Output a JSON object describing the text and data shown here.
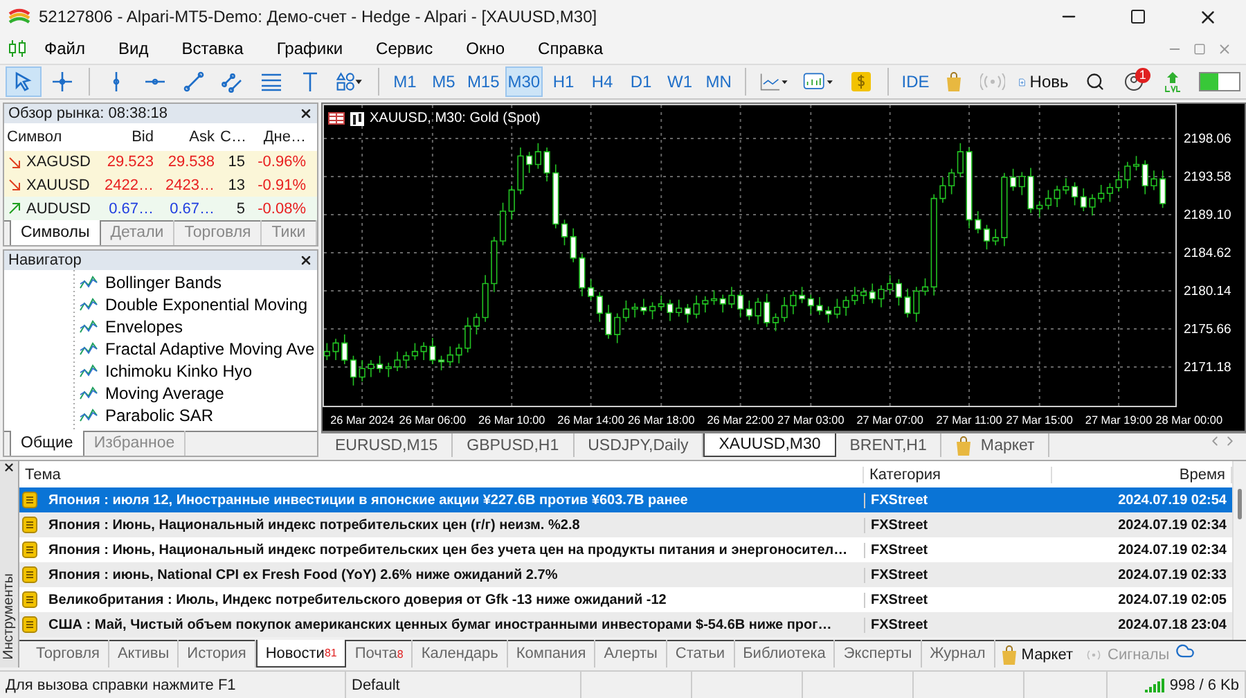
{
  "window": {
    "title": "52127806 - Alpari-MT5-Demo: Демо-счет - Hedge - Alpari - [XAUUSD,M30]"
  },
  "menu": [
    "Файл",
    "Вид",
    "Вставка",
    "Графики",
    "Сервис",
    "Окно",
    "Справка"
  ],
  "toolbar": {
    "tools": [
      {
        "kind": "cursor",
        "selected": true
      },
      {
        "kind": "crosshair",
        "selected": false
      },
      {
        "kind": "vline",
        "selected": false
      },
      {
        "kind": "hline",
        "selected": false
      },
      {
        "kind": "trendline",
        "selected": false
      },
      {
        "kind": "channel",
        "selected": false
      },
      {
        "kind": "fibo",
        "selected": false
      },
      {
        "kind": "text",
        "selected": false
      },
      {
        "kind": "shapes",
        "selected": false
      }
    ],
    "timeframes": [
      {
        "label": "M1",
        "selected": false
      },
      {
        "label": "M5",
        "selected": false
      },
      {
        "label": "M15",
        "selected": false
      },
      {
        "label": "M30",
        "selected": true
      },
      {
        "label": "H1",
        "selected": false
      },
      {
        "label": "H4",
        "selected": false
      },
      {
        "label": "D1",
        "selected": false
      },
      {
        "label": "W1",
        "selected": false
      },
      {
        "label": "MN",
        "selected": false
      }
    ],
    "ide": "IDE",
    "new_order": "Новь",
    "notification_count": "1",
    "level": 0.45
  },
  "market_watch": {
    "title": "Обзор рынка: 08:38:18",
    "columns": [
      "Символ",
      "Bid",
      "Ask",
      "С…",
      "Дне…"
    ],
    "rows": [
      {
        "symbol": "XAGUSD",
        "bid": "29.523",
        "ask": "29.538",
        "spread": "15",
        "change": "-0.96%",
        "kind": "down"
      },
      {
        "symbol": "XAUUSD",
        "bid": "2422…",
        "ask": "2423…",
        "spread": "13",
        "change": "-0.91%",
        "kind": "down"
      },
      {
        "symbol": "AUDUSD",
        "bid": "0.67…",
        "ask": "0.67…",
        "spread": "5",
        "change": "-0.08%",
        "kind": "up"
      }
    ],
    "tabs": [
      {
        "label": "Символы",
        "selected": true
      },
      {
        "label": "Детали",
        "selected": false
      },
      {
        "label": "Торговля",
        "selected": false
      },
      {
        "label": "Тики",
        "selected": false
      }
    ]
  },
  "navigator": {
    "title": "Навигатор",
    "items": [
      "Bollinger Bands",
      "Double Exponential Moving",
      "Envelopes",
      "Fractal Adaptive Moving Ave",
      "Ichimoku Kinko Hyo",
      "Moving Average",
      "Parabolic SAR"
    ],
    "tabs": [
      {
        "label": "Общие",
        "selected": true
      },
      {
        "label": "Избранное",
        "selected": false
      }
    ]
  },
  "chart": {
    "chart_data": {
      "type": "candlestick",
      "title": "XAUUSD, M30:  Gold (Spot)",
      "grid": true,
      "categories": [
        null,
        null,
        null,
        null,
        "26 Mar 2024",
        null,
        null,
        null,
        null,
        null,
        null,
        null,
        "26 Mar 06:00",
        null,
        null,
        null,
        null,
        null,
        null,
        null,
        null,
        "26 Mar 10:00",
        null,
        null,
        null,
        null,
        null,
        null,
        null,
        null,
        "26 Mar 14:00",
        null,
        null,
        null,
        null,
        null,
        null,
        null,
        "26 Mar 18:00",
        null,
        null,
        null,
        null,
        null,
        null,
        null,
        null,
        "26 Mar 22:00",
        null,
        null,
        null,
        null,
        null,
        null,
        null,
        "27 Mar 03:00",
        null,
        null,
        null,
        null,
        null,
        null,
        null,
        null,
        "27 Mar 07:00",
        null,
        null,
        null,
        null,
        null,
        null,
        null,
        null,
        "27 Mar 11:00",
        null,
        null,
        null,
        null,
        null,
        null,
        null,
        "27 Mar 15:00",
        null,
        null,
        null,
        null,
        null,
        null,
        null,
        null,
        "27 Mar 19:00",
        null,
        null,
        null,
        null,
        null,
        null,
        null,
        "28 Mar 00:00"
      ],
      "ohlc": [
        [
          2172.5,
          2174,
          2172,
          2173
        ],
        [
          2173,
          2174.5,
          2172,
          2174
        ],
        [
          2174,
          2175,
          2171.5,
          2172
        ],
        [
          2172,
          2172.5,
          2169,
          2170
        ],
        [
          2170,
          2172,
          2169.5,
          2171
        ],
        [
          2171,
          2172,
          2170,
          2171.5
        ],
        [
          2171.5,
          2172.5,
          2170.5,
          2171
        ],
        [
          2171,
          2171.7,
          2170,
          2171.2
        ],
        [
          2171.2,
          2173,
          2170.7,
          2172
        ],
        [
          2172,
          2173,
          2171,
          2172.5
        ],
        [
          2172.5,
          2174,
          2172,
          2173
        ],
        [
          2173,
          2174.1,
          2172,
          2173.6
        ],
        [
          2173.6,
          2174.6,
          2171.5,
          2172
        ],
        [
          2172,
          2172.5,
          2170.8,
          2171.8
        ],
        [
          2171.8,
          2173.6,
          2171.3,
          2172.6
        ],
        [
          2172.6,
          2173.9,
          2171.6,
          2173.4
        ],
        [
          2173.4,
          2177,
          2172.9,
          2176
        ],
        [
          2176,
          2177.5,
          2175,
          2177
        ],
        [
          2177,
          2182,
          2176.5,
          2181
        ],
        [
          2181,
          2186.5,
          2180,
          2186
        ],
        [
          2186,
          2190.5,
          2185.5,
          2189.5
        ],
        [
          2189.5,
          2192.5,
          2188.5,
          2192
        ],
        [
          2192,
          2197,
          2191.5,
          2196
        ],
        [
          2196,
          2196.5,
          2194,
          2195
        ],
        [
          2195,
          2197.5,
          2194.5,
          2196.5
        ],
        [
          2196.5,
          2197,
          2193,
          2194
        ],
        [
          2194,
          2195,
          2187.5,
          2188
        ],
        [
          2188,
          2188.5,
          2185.5,
          2186.5
        ],
        [
          2186.5,
          2187.5,
          2183.5,
          2184
        ],
        [
          2184,
          2184.5,
          2179.5,
          2180.5
        ],
        [
          2180.5,
          2181.5,
          2179,
          2179.5
        ],
        [
          2179.5,
          2180,
          2176.5,
          2177.5
        ],
        [
          2177.5,
          2178.5,
          2174.5,
          2175
        ],
        [
          2175,
          2177.5,
          2174,
          2177
        ],
        [
          2177,
          2179,
          2176.5,
          2178
        ],
        [
          2178,
          2178.7,
          2177,
          2178.2
        ],
        [
          2178.2,
          2179.2,
          2177.3,
          2177.8
        ],
        [
          2177.8,
          2178.8,
          2176.8,
          2178.3
        ],
        [
          2178.3,
          2179.6,
          2177.8,
          2178.6
        ],
        [
          2178.6,
          2179.1,
          2176.6,
          2177.6
        ],
        [
          2177.6,
          2179.1,
          2177.1,
          2178.1
        ],
        [
          2178.1,
          2178.6,
          2176.4,
          2177.4
        ],
        [
          2177.4,
          2179.6,
          2176.9,
          2178.6
        ],
        [
          2178.6,
          2179.5,
          2177.6,
          2179
        ],
        [
          2179,
          2180.2,
          2178.5,
          2179.2
        ],
        [
          2179.2,
          2179.7,
          2177.6,
          2178.6
        ],
        [
          2178.6,
          2180.6,
          2178.1,
          2179.6
        ],
        [
          2179.6,
          2180.1,
          2177,
          2178
        ],
        [
          2178,
          2179,
          2176.7,
          2177.2
        ],
        [
          2177.2,
          2179.3,
          2176.2,
          2178.8
        ],
        [
          2178.8,
          2179.8,
          2175.9,
          2176.4
        ],
        [
          2176.4,
          2177.5,
          2175.4,
          2177
        ],
        [
          2177,
          2179.4,
          2176.5,
          2178.4
        ],
        [
          2178.4,
          2180.1,
          2177.4,
          2179.6
        ],
        [
          2179.6,
          2180.6,
          2178.7,
          2179.2
        ],
        [
          2179.2,
          2179.7,
          2177.4,
          2178.4
        ],
        [
          2178.4,
          2179.4,
          2177.3,
          2177.8
        ],
        [
          2177.8,
          2178.3,
          2176.4,
          2177.4
        ],
        [
          2177.4,
          2179.2,
          2176.9,
          2178.2
        ],
        [
          2178.2,
          2179.5,
          2177.2,
          2179
        ],
        [
          2179,
          2180.6,
          2178.5,
          2179.6
        ],
        [
          2179.6,
          2180.5,
          2178.6,
          2180
        ],
        [
          2180,
          2181,
          2178.7,
          2179.2
        ],
        [
          2179.2,
          2180.8,
          2178.2,
          2180.3
        ],
        [
          2180.3,
          2182,
          2179.8,
          2181
        ],
        [
          2181,
          2181.5,
          2178.4,
          2179.4
        ],
        [
          2179.4,
          2180.4,
          2177,
          2177.5
        ],
        [
          2177.5,
          2180.6,
          2176.5,
          2180.1
        ],
        [
          2180.1,
          2181.6,
          2179.6,
          2180.6
        ],
        [
          2180.6,
          2191.5,
          2179.6,
          2191
        ],
        [
          2191,
          2193.5,
          2190.5,
          2192.5
        ],
        [
          2192.5,
          2194.5,
          2191.5,
          2194
        ],
        [
          2194,
          2197.5,
          2193.5,
          2196.5
        ],
        [
          2196.5,
          2197,
          2187.5,
          2188.5
        ],
        [
          2188.5,
          2189.5,
          2186.9,
          2187.4
        ],
        [
          2187.4,
          2187.9,
          2185,
          2186
        ],
        [
          2186,
          2187.4,
          2185.5,
          2186.4
        ],
        [
          2186.4,
          2194,
          2185.4,
          2193.5
        ],
        [
          2193.5,
          2194.5,
          2191.9,
          2192.4
        ],
        [
          2192.4,
          2194.1,
          2191.4,
          2193.6
        ],
        [
          2193.6,
          2194.6,
          2189.3,
          2189.8
        ],
        [
          2189.8,
          2190.7,
          2188.8,
          2190.2
        ],
        [
          2190.2,
          2192,
          2189.7,
          2191
        ],
        [
          2191,
          2192.5,
          2190,
          2192
        ],
        [
          2192,
          2193.4,
          2191.5,
          2192.4
        ],
        [
          2192.4,
          2192.9,
          2190.2,
          2191.2
        ],
        [
          2191.2,
          2192.2,
          2189.5,
          2190
        ],
        [
          2190,
          2191.5,
          2189,
          2191
        ],
        [
          2191,
          2192.6,
          2190.5,
          2191.6
        ],
        [
          2191.6,
          2192.8,
          2190.6,
          2192.3
        ],
        [
          2192.3,
          2194.2,
          2191.8,
          2193.2
        ],
        [
          2193.2,
          2195.3,
          2192.2,
          2194.8
        ],
        [
          2194.8,
          2196,
          2194.3,
          2195
        ],
        [
          2195,
          2195.5,
          2191.5,
          2192.5
        ],
        [
          2192.5,
          2194.3,
          2192,
          2193.3
        ],
        [
          2193.3,
          2194.3,
          2189.9,
          2190.4
        ],
        null,
        null,
        null
      ],
      "ylim": [
        2166.62,
        2202.13
      ],
      "yticks": [
        {
          "value": 2198.06,
          "label": "2198.06"
        },
        {
          "value": 2193.58,
          "label": "2193.58"
        },
        {
          "value": 2189.1,
          "label": "2189.10"
        },
        {
          "value": 2184.62,
          "label": "2184.62"
        },
        {
          "value": 2180.14,
          "label": "2180.14"
        },
        {
          "value": 2175.66,
          "label": "2175.66"
        },
        {
          "value": 2171.18,
          "label": "2171.18"
        }
      ]
    },
    "tabs": [
      {
        "label": "EURUSD,M15",
        "selected": false
      },
      {
        "label": "GBPUSD,H1",
        "selected": false
      },
      {
        "label": "USDJPY,Daily",
        "selected": false
      },
      {
        "label": "XAUUSD,M30",
        "selected": true
      },
      {
        "label": "BRENT,H1",
        "selected": false
      }
    ],
    "market_tab": "Маркет"
  },
  "toolbox": {
    "side_label": "Инструменты",
    "columns": [
      "Тема",
      "Категория",
      "Время"
    ],
    "rows": [
      {
        "topic": "Япония : июля 12, Иностранные инвестиции в японские акции  ¥227.6B против ¥603.7B ранее",
        "category": "FXStreet",
        "time": "2024.07.19 02:54",
        "selected": true
      },
      {
        "topic": "Япония : Июнь, Национальный индекс потребительских цен (г/г) неизм. %2.8",
        "category": "FXStreet",
        "time": "2024.07.19 02:34",
        "selected": false
      },
      {
        "topic": "Япония : Июнь, Национальный индекс потребительских цен без учета цен на продукты питания и энергоносител…",
        "category": "FXStreet",
        "time": "2024.07.19 02:34",
        "selected": false
      },
      {
        "topic": "Япония : июнь, National CPI ex Fresh Food (YoY)  2.6% ниже ожиданий 2.7%",
        "category": "FXStreet",
        "time": "2024.07.19 02:33",
        "selected": false
      },
      {
        "topic": "Великобритания : Июль, Индекс потребительского доверия от Gfk   -13 ниже ожиданий -12",
        "category": "FXStreet",
        "time": "2024.07.19 02:05",
        "selected": false
      },
      {
        "topic": "США : Май, Чистый объем покупок американских ценных бумаг иностранными инвесторами  $-54.6B ниже прог…",
        "category": "FXStreet",
        "time": "2024.07.18 23:04",
        "selected": false
      }
    ],
    "tabs": [
      {
        "label": "Торговля",
        "selected": false
      },
      {
        "label": "Активы",
        "selected": false
      },
      {
        "label": "История",
        "selected": false
      },
      {
        "label": "Новости",
        "selected": true,
        "badge": "81"
      },
      {
        "label": "Почта",
        "selected": false,
        "badge": "8"
      },
      {
        "label": "Календарь",
        "selected": false
      },
      {
        "label": "Компания",
        "selected": false
      },
      {
        "label": "Алерты",
        "selected": false
      },
      {
        "label": "Статьи",
        "selected": false
      },
      {
        "label": "Библиотека",
        "selected": false
      },
      {
        "label": "Эксперты",
        "selected": false
      },
      {
        "label": "Журнал",
        "selected": false
      }
    ],
    "market": "Маркет",
    "signals": "Сигналы"
  },
  "status_bar": {
    "help": "Для вызова справки нажмите F1",
    "profile": "Default",
    "traffic": "998 / 6 Kb"
  }
}
